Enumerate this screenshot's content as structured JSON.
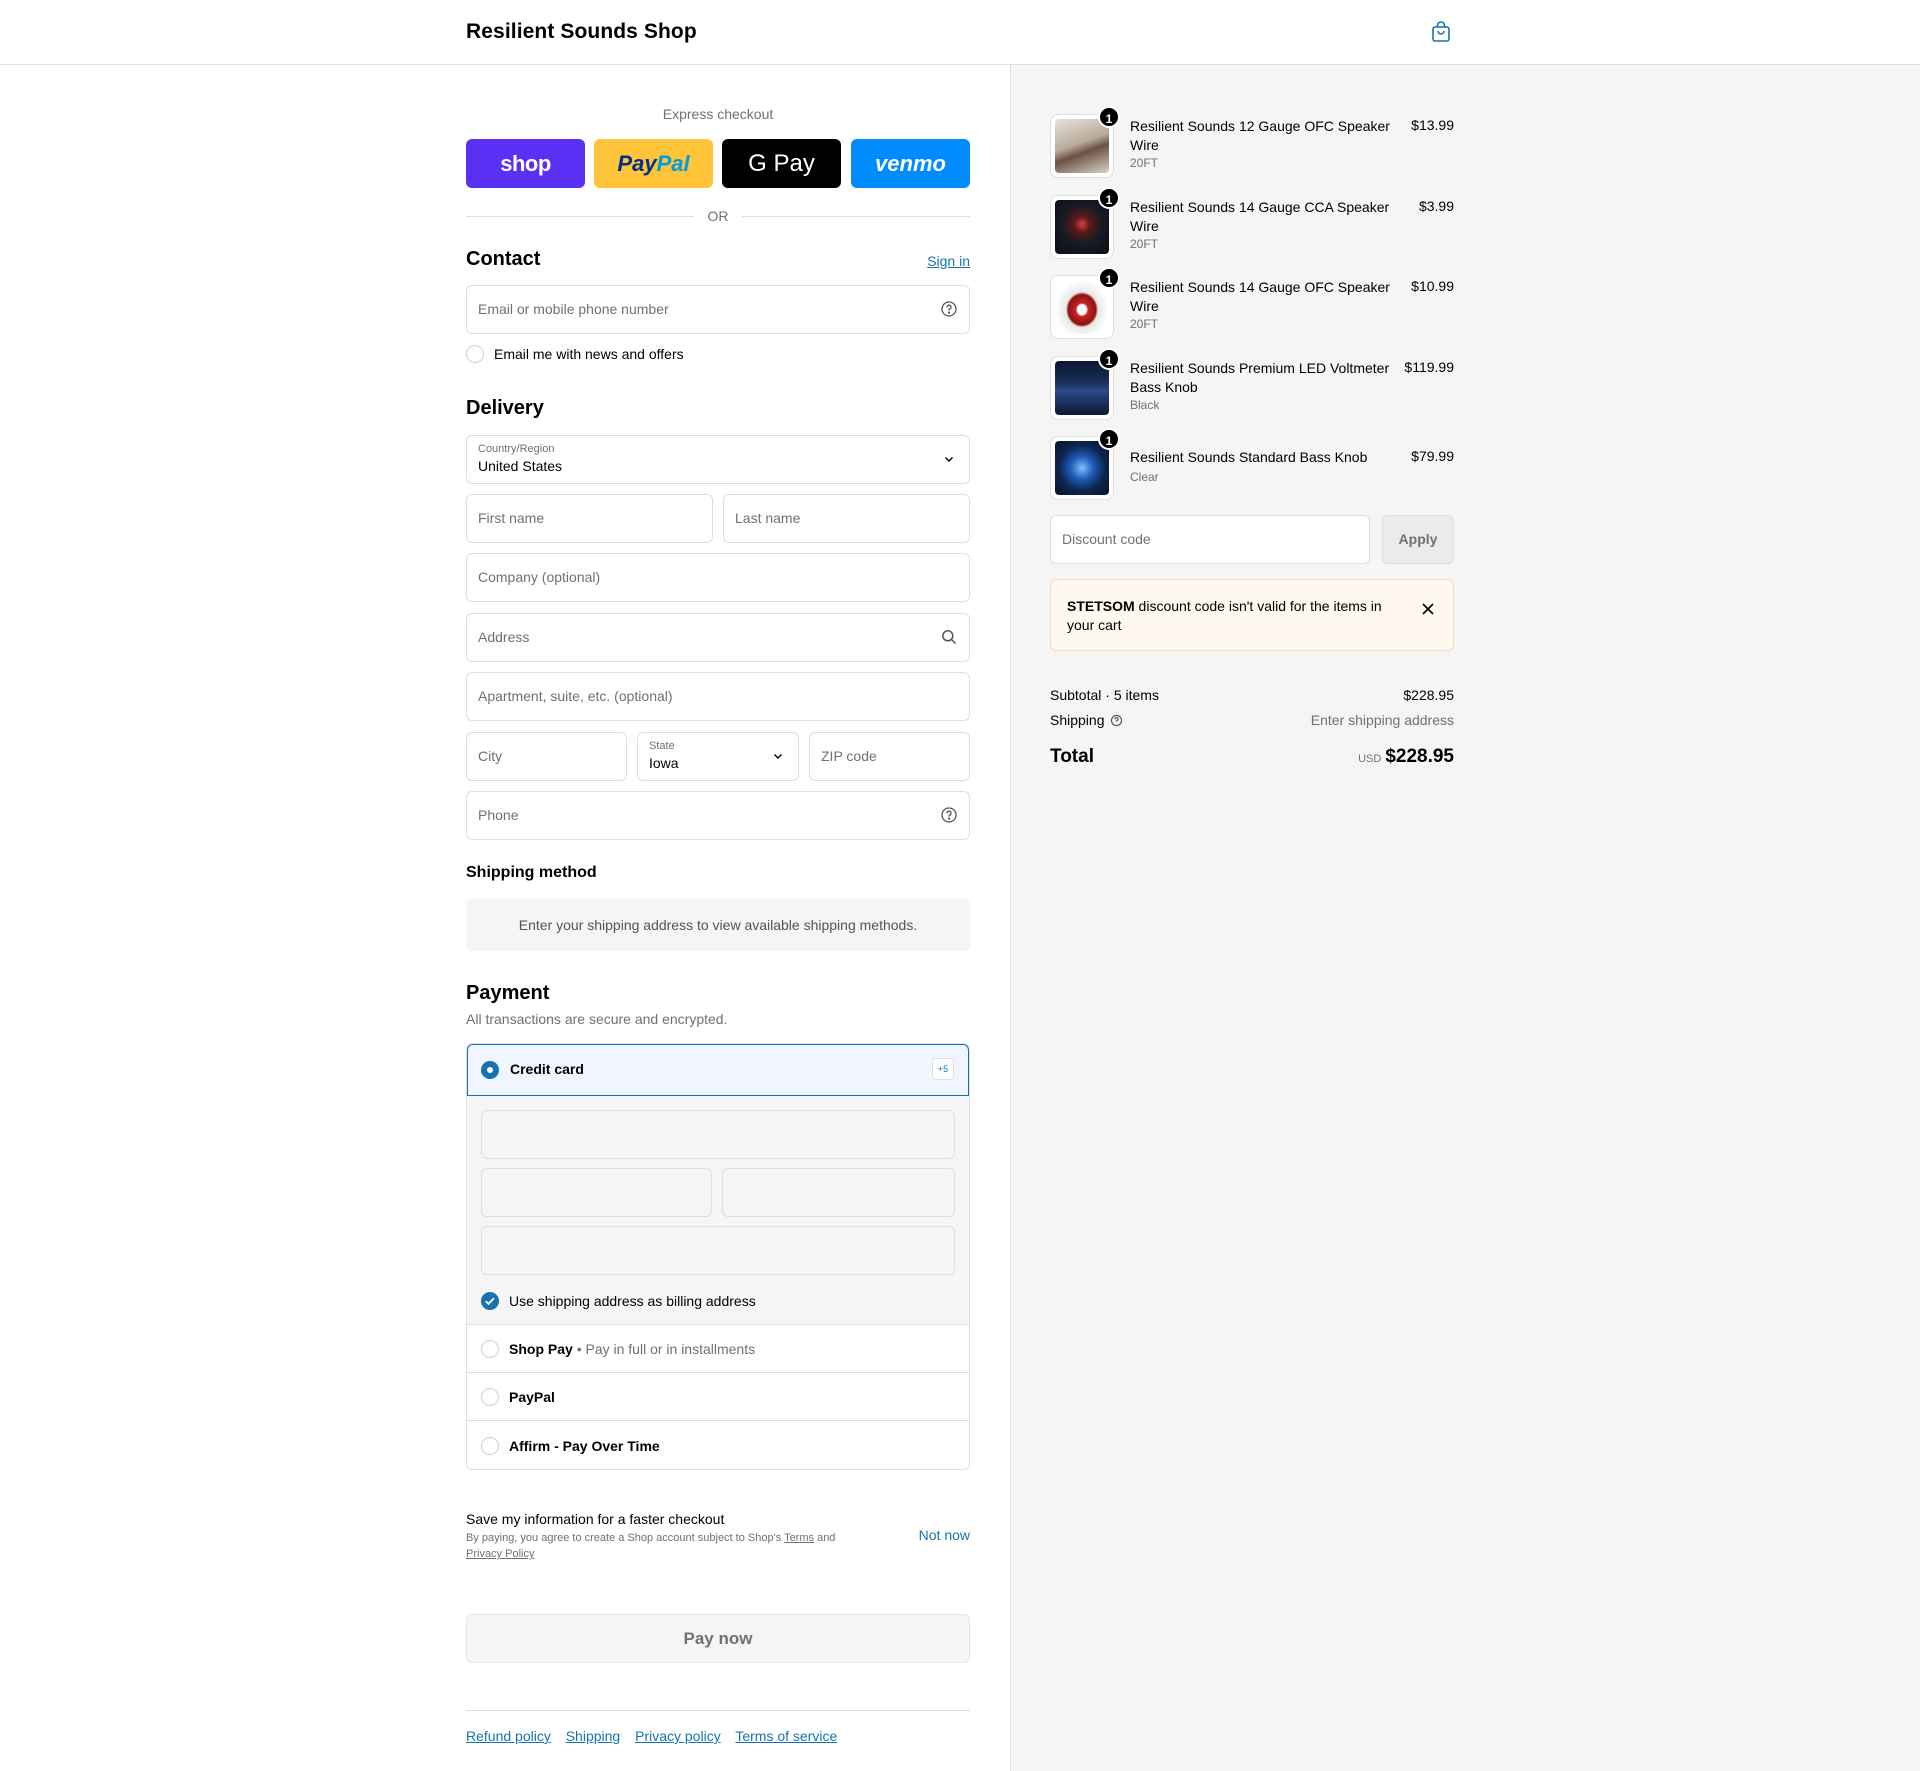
{
  "header": {
    "title": "Resilient Sounds Shop"
  },
  "express": {
    "label": "Express checkout",
    "buttons": {
      "shop": "shop",
      "paypal_a": "Pay",
      "paypal_b": "Pal",
      "gpay": "G Pay",
      "venmo": "venmo"
    },
    "or": "OR"
  },
  "contact": {
    "heading": "Contact",
    "sign_in": "Sign in",
    "email_placeholder": "Email or mobile phone number",
    "newsletter": "Email me with news and offers"
  },
  "delivery": {
    "heading": "Delivery",
    "country_label": "Country/Region",
    "country_value": "United States",
    "first_name": "First name",
    "last_name": "Last name",
    "company": "Company (optional)",
    "address": "Address",
    "apartment": "Apartment, suite, etc. (optional)",
    "city": "City",
    "state_label": "State",
    "state_value": "Iowa",
    "zip": "ZIP code",
    "phone": "Phone"
  },
  "shipping_method": {
    "heading": "Shipping method",
    "info": "Enter your shipping address to view available shipping methods."
  },
  "payment": {
    "heading": "Payment",
    "subtitle": "All transactions are secure and encrypted.",
    "credit_card": "Credit card",
    "more_badge": "+5",
    "billing_same": "Use shipping address as billing address",
    "shop_pay": "Shop Pay",
    "shop_pay_sub": "• Pay in full or in installments",
    "paypal": "PayPal",
    "affirm": "Affirm - Pay Over Time"
  },
  "save_info": {
    "title": "Save my information for a faster checkout",
    "terms_a": "By paying, you agree to create a Shop account subject to Shop's ",
    "terms_link": "Terms",
    "terms_and": " and",
    "privacy_link": "Privacy Policy",
    "not_now": "Not now"
  },
  "pay_now": "Pay now",
  "footer": {
    "links": [
      "Refund policy",
      "Shipping",
      "Privacy policy",
      "Terms of service"
    ]
  },
  "cart": {
    "items": [
      {
        "qty": "1",
        "name": "Resilient Sounds 12 Gauge OFC Speaker Wire",
        "variant": "20FT",
        "price": "$13.99"
      },
      {
        "qty": "1",
        "name": "Resilient Sounds 14 Gauge CCA Speaker Wire",
        "variant": "20FT",
        "price": "$3.99"
      },
      {
        "qty": "1",
        "name": "Resilient Sounds 14 Gauge OFC Speaker Wire",
        "variant": "20FT",
        "price": "$10.99"
      },
      {
        "qty": "1",
        "name": "Resilient Sounds Premium LED Voltmeter Bass Knob",
        "variant": "Black",
        "price": "$119.99"
      },
      {
        "qty": "1",
        "name": "Resilient Sounds Standard Bass Knob",
        "variant": "Clear",
        "price": "$79.99"
      }
    ],
    "discount_placeholder": "Discount code",
    "apply": "Apply",
    "banner_code": "STETSOM",
    "banner_msg": " discount code isn't valid for the items in your cart",
    "subtotal_label": "Subtotal · 5 items",
    "subtotal_value": "$228.95",
    "shipping_label": "Shipping",
    "shipping_value": "Enter shipping address",
    "total_label": "Total",
    "currency": "USD",
    "total_value": "$228.95"
  },
  "colors": {
    "accent": "#1773b0",
    "shop_purple": "#5a31f4",
    "paypal_yellow": "#ffc439",
    "venmo_blue": "#008cff"
  }
}
